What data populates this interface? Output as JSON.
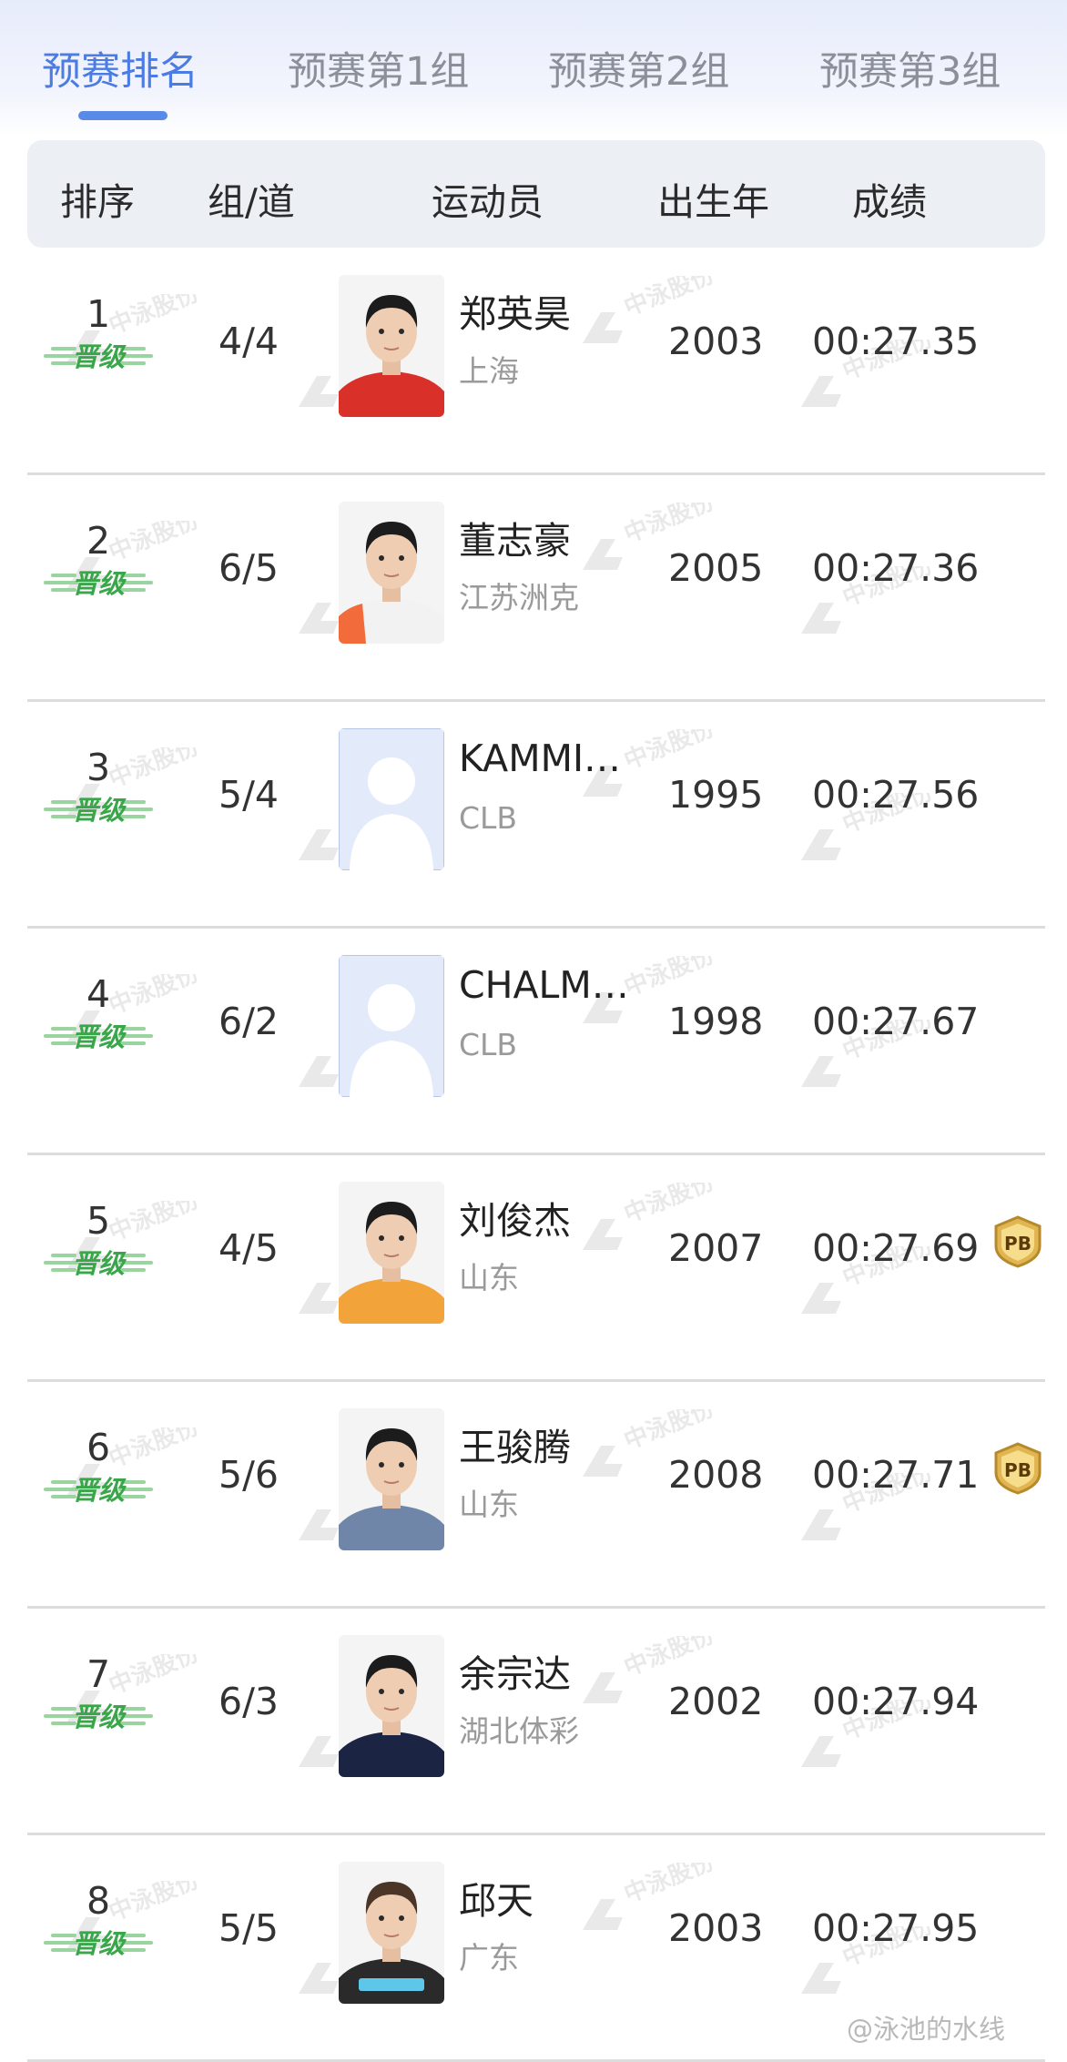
{
  "tabs": [
    "预赛排名",
    "预赛第1组",
    "预赛第2组",
    "预赛第3组"
  ],
  "active_tab": 0,
  "headers": {
    "rank": "排序",
    "lane": "组/道",
    "athlete": "运动员",
    "birth": "出生年",
    "result": "成绩"
  },
  "advance_label": "晋级",
  "pb_label": "PB",
  "watermark_text": "中泳股份",
  "rows": [
    {
      "rank": "1",
      "lane": "4/4",
      "name": "郑英昊",
      "team": "上海",
      "birth": "2003",
      "result": "00:27.35",
      "pb": false,
      "photo": "jersey-red"
    },
    {
      "rank": "2",
      "lane": "6/5",
      "name": "董志豪",
      "team": "江苏洲克",
      "birth": "2005",
      "result": "00:27.36",
      "pb": false,
      "photo": "jersey-orange-white"
    },
    {
      "rank": "3",
      "lane": "5/4",
      "name": "KAMMI…",
      "team": "CLB",
      "birth": "1995",
      "result": "00:27.56",
      "pb": false,
      "photo": "placeholder"
    },
    {
      "rank": "4",
      "lane": "6/2",
      "name": "CHALM…",
      "team": "CLB",
      "birth": "1998",
      "result": "00:27.67",
      "pb": false,
      "photo": "placeholder"
    },
    {
      "rank": "5",
      "lane": "4/5",
      "name": "刘俊杰",
      "team": "山东",
      "birth": "2007",
      "result": "00:27.69",
      "pb": true,
      "photo": "jersey-orange"
    },
    {
      "rank": "6",
      "lane": "5/6",
      "name": "王骏腾",
      "team": "山东",
      "birth": "2008",
      "result": "00:27.71",
      "pb": true,
      "photo": "jersey-blue-pattern"
    },
    {
      "rank": "7",
      "lane": "6/3",
      "name": "余宗达",
      "team": "湖北体彩",
      "birth": "2002",
      "result": "00:27.94",
      "pb": false,
      "photo": "jersey-navy"
    },
    {
      "rank": "8",
      "lane": "5/5",
      "name": "邱天",
      "team": "广东",
      "birth": "2003",
      "result": "00:27.95",
      "pb": false,
      "photo": "jersey-black"
    }
  ],
  "colors": {
    "accent": "#4b7be3",
    "advance_green": "#3aa64a",
    "pb_gold": "#c9a040"
  },
  "footer_watermark": "@泳池的水线"
}
